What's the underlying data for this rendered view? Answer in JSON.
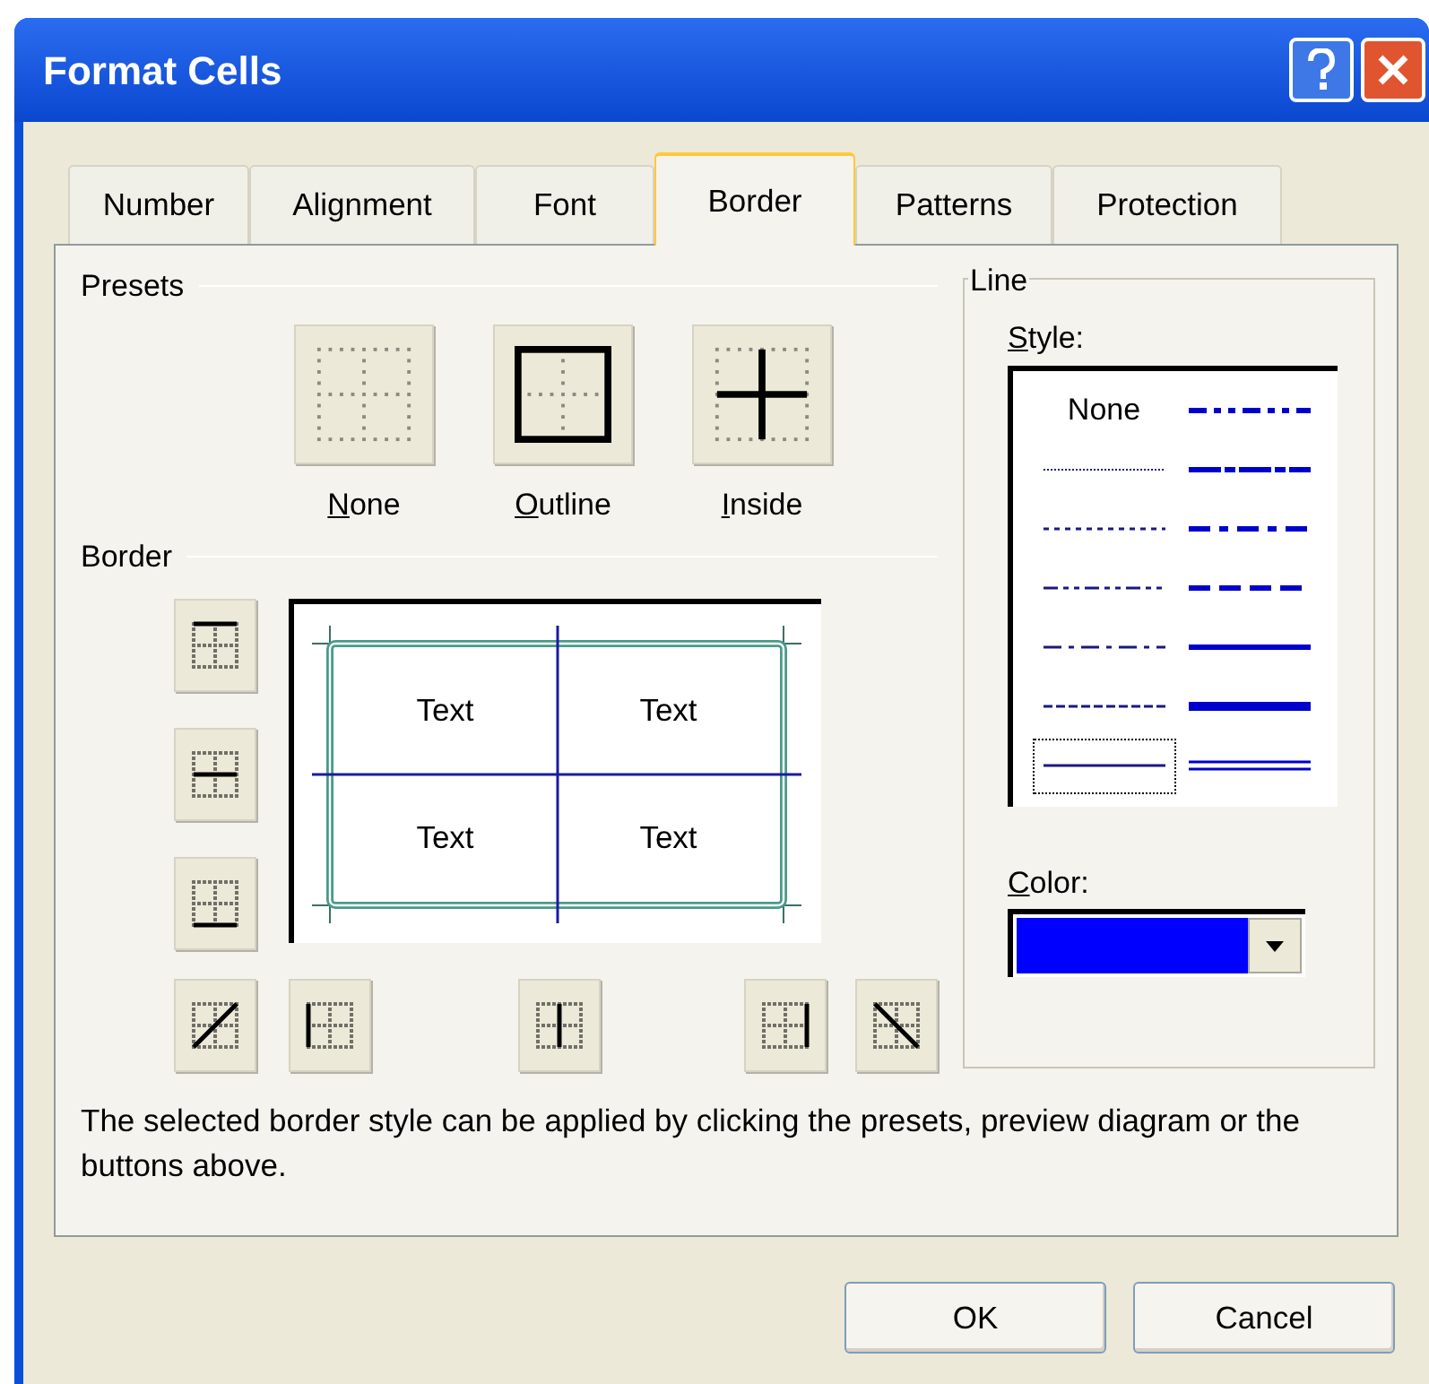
{
  "window": {
    "title": "Format Cells"
  },
  "tabs": [
    {
      "label": "Number",
      "selected": false
    },
    {
      "label": "Alignment",
      "selected": false
    },
    {
      "label": "Font",
      "selected": false
    },
    {
      "label": "Border",
      "selected": true
    },
    {
      "label": "Patterns",
      "selected": false
    },
    {
      "label": "Protection",
      "selected": false
    }
  ],
  "presets": {
    "title": "Presets",
    "buttons": [
      {
        "kind": "none",
        "label": "None"
      },
      {
        "kind": "outline",
        "label": "Outline"
      },
      {
        "kind": "inside",
        "label": "Inside"
      }
    ]
  },
  "border": {
    "title": "Border",
    "side_buttons": [
      {
        "kind": "top"
      },
      {
        "kind": "middle-h"
      },
      {
        "kind": "bottom"
      }
    ],
    "bottom_buttons": [
      {
        "kind": "diag-up"
      },
      {
        "kind": "left"
      },
      {
        "kind": "middle-v"
      },
      {
        "kind": "right"
      },
      {
        "kind": "diag-down"
      }
    ],
    "preview_cells": [
      "Text",
      "Text",
      "Text",
      "Text"
    ]
  },
  "line": {
    "title": "Line",
    "style_label": "Style:",
    "styles": [
      {
        "kind": "none",
        "label": "None",
        "selected": false
      },
      {
        "kind": "hair",
        "selected": false
      },
      {
        "kind": "dotted",
        "selected": false
      },
      {
        "kind": "dash-dot-dot",
        "selected": false
      },
      {
        "kind": "dash-dot",
        "selected": false
      },
      {
        "kind": "dashed",
        "selected": false
      },
      {
        "kind": "thin",
        "selected": true
      },
      {
        "kind": "medium-dash-dot-dot",
        "selected": false
      },
      {
        "kind": "slanted",
        "selected": false
      },
      {
        "kind": "medium-dash-dot",
        "selected": false
      },
      {
        "kind": "medium-dashed",
        "selected": false
      },
      {
        "kind": "medium",
        "selected": false
      },
      {
        "kind": "thick",
        "selected": false
      },
      {
        "kind": "double",
        "selected": false
      }
    ],
    "color_label": "Color:",
    "color": "#0000ff"
  },
  "hint": "The selected border style can be applied by clicking the presets, preview diagram or the buttons above.",
  "buttons": [
    {
      "label": "OK"
    },
    {
      "label": "Cancel"
    }
  ]
}
